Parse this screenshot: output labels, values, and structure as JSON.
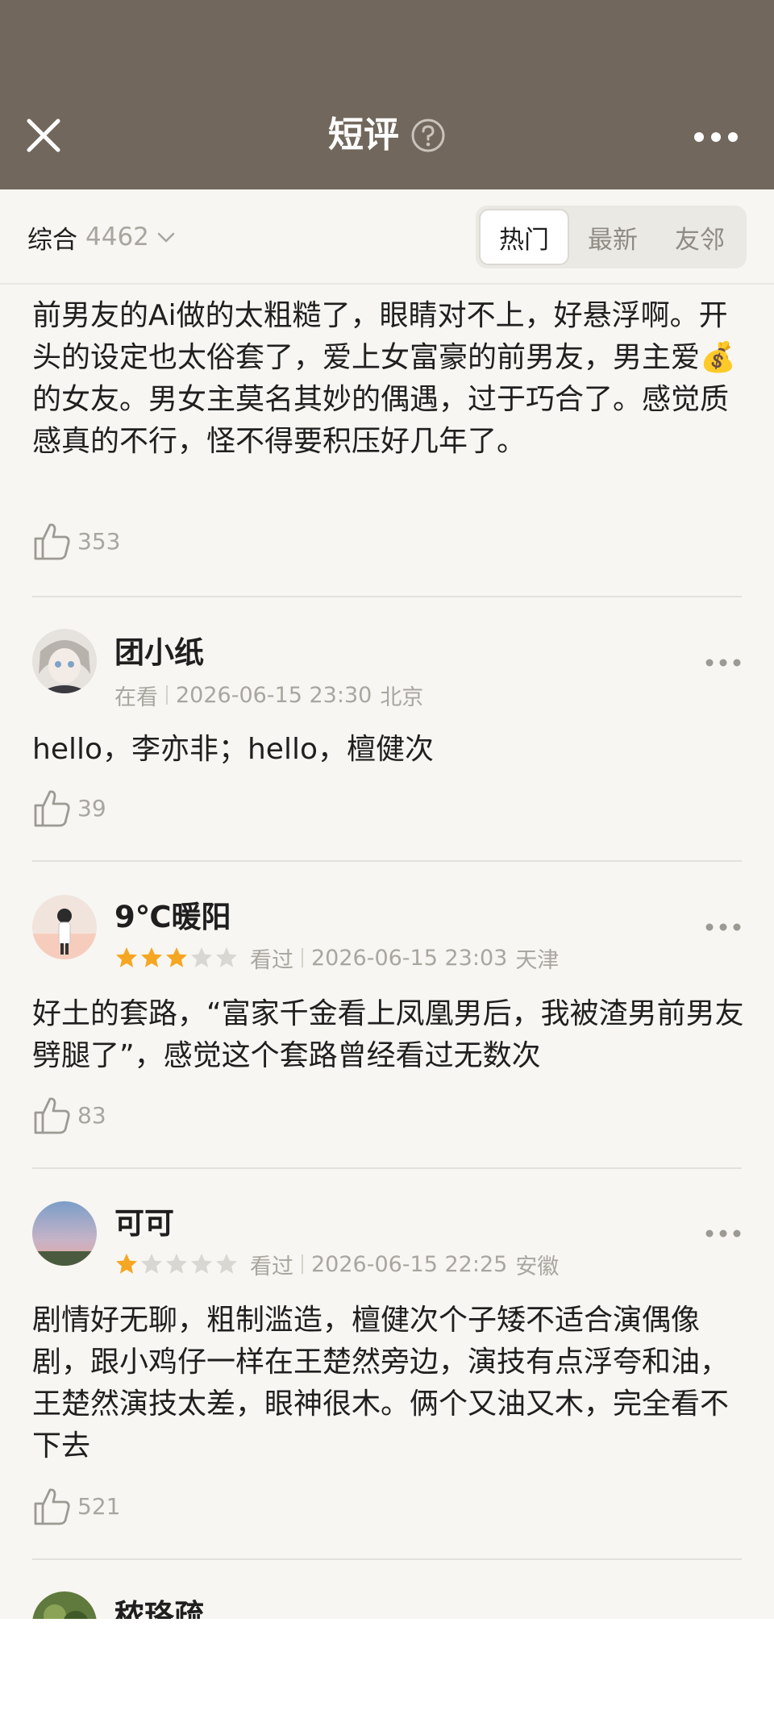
{
  "header": {
    "title": "短评"
  },
  "filter": {
    "sort_label": "综合",
    "count": "4462",
    "tabs": [
      {
        "label": "热门"
      },
      {
        "label": "最新"
      },
      {
        "label": "友邻"
      }
    ]
  },
  "reviews": [
    {
      "text": "前男友的Ai做的太粗糙了，眼睛对不上，好悬浮啊。开头的设定也太俗套了，爱上女富豪的前男友，男主爱💰的女友。男女主莫名其妙的偶遇，过于巧合了。感觉质感真的不行，怪不得要积压好几年了。",
      "likes": "353"
    },
    {
      "user": "团小纸",
      "status": "在看",
      "datetime": "2026-06-15 23:30",
      "location": "北京",
      "text": "hello，李亦非；hello，檀健次",
      "likes": "39"
    },
    {
      "user": "9℃暖阳",
      "rating": 3,
      "status": "看过",
      "datetime": "2026-06-15 23:03",
      "location": "天津",
      "text": "好土的套路，“富家千金看上凤凰男后，我被渣男前男友劈腿了”，感觉这个套路曾经看过无数次",
      "likes": "83"
    },
    {
      "user": "可可",
      "rating": 1,
      "status": "看过",
      "datetime": "2026-06-15 22:25",
      "location": "安徽",
      "text": "剧情好无聊，粗制滥造，檀健次个子矮不适合演偶像剧，跟小鸡仔一样在王楚然旁边，演技有点浮夸和油，王楚然演技太差，眼神很木。俩个又油又木，完全看不下去",
      "likes": "521"
    },
    {
      "user": "秾珞疏"
    }
  ],
  "colors": {
    "header_bg": "#71675c",
    "star_on": "#f5a623",
    "star_off": "#d9d7d2"
  }
}
